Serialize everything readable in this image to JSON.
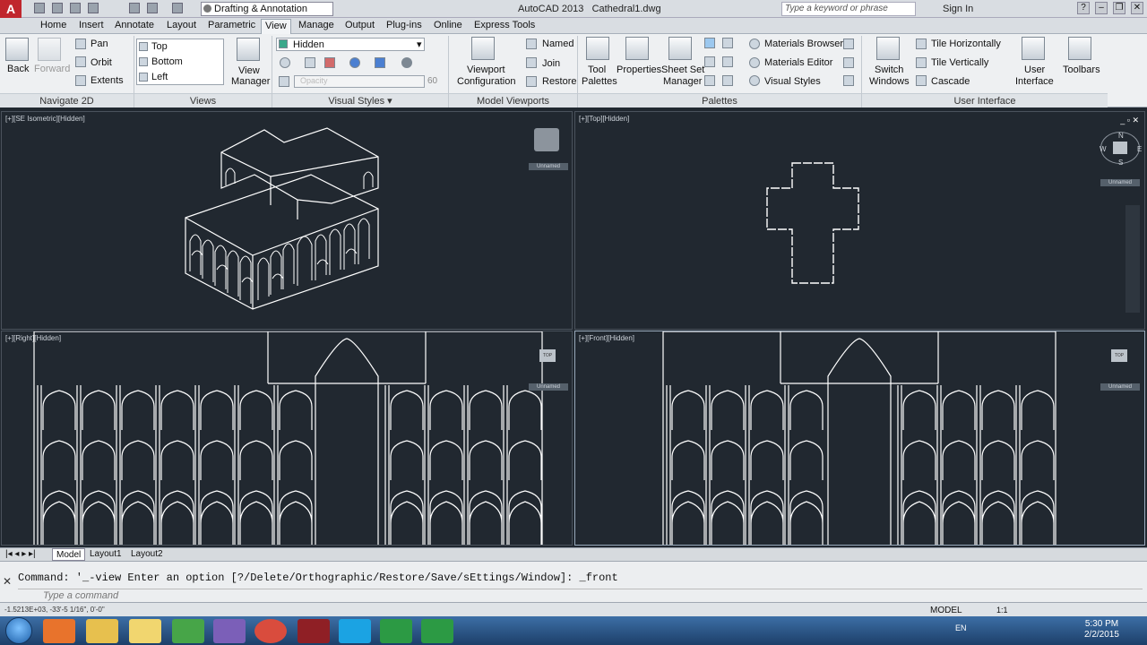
{
  "window": {
    "app_title": "AutoCAD 2013",
    "file_name": "Cathedral1.dwg",
    "workspace": "Drafting & Annotation",
    "search_placeholder": "Type a keyword or phrase",
    "sign_in": "Sign In"
  },
  "menu": {
    "tabs": [
      "Home",
      "Insert",
      "Annotate",
      "Layout",
      "Parametric",
      "View",
      "Manage",
      "Output",
      "Plug-ins",
      "Online",
      "Express Tools"
    ],
    "active": "View"
  },
  "ribbon": {
    "navigate2d": {
      "back": "Back",
      "forward": "Forward",
      "pan": "Pan",
      "orbit": "Orbit",
      "extents": "Extents",
      "title": "Navigate 2D"
    },
    "views": {
      "items": [
        "Top",
        "Bottom",
        "Left"
      ],
      "view_manager_1": "View",
      "view_manager_2": "Manager",
      "title": "Views"
    },
    "visual_styles": {
      "current": "Hidden",
      "opacity_label": "Opacity",
      "opacity_value": "60",
      "title": "Visual Styles"
    },
    "model_viewports": {
      "config_1": "Viewport",
      "config_2": "Configuration",
      "named": "Named",
      "join": "Join",
      "restore": "Restore",
      "title": "Model Viewports"
    },
    "palettes": {
      "tool_palettes_1": "Tool",
      "tool_palettes_2": "Palettes",
      "properties": "Properties",
      "sheet_set_1": "Sheet Set",
      "sheet_set_2": "Manager",
      "materials_browser": "Materials Browser",
      "materials_editor": "Materials Editor",
      "visual_styles": "Visual Styles",
      "title": "Palettes"
    },
    "user_interface": {
      "switch_1": "Switch",
      "switch_2": "Windows",
      "tile_h": "Tile Horizontally",
      "tile_v": "Tile Vertically",
      "cascade": "Cascade",
      "ui_1": "User",
      "ui_2": "Interface",
      "toolbars": "Toolbars",
      "title": "User Interface"
    }
  },
  "viewports": {
    "sw_iso": "[+][SE Isometric][Hidden]",
    "top": "[+][Top][Hidden]",
    "right": "[+][Right][Hidden]",
    "front": "[+][Front][Hidden]",
    "unnamed": "Unnamed",
    "viewcube_top": "TOP",
    "compass": {
      "n": "N",
      "w": "W",
      "e": "E",
      "s": "S"
    }
  },
  "layout_tabs": [
    "Model",
    "Layout1",
    "Layout2"
  ],
  "command": {
    "history": "Command: '_-view Enter an option [?/Delete/Orthographic/Restore/Save/sEttings/Window]: _front",
    "placeholder": "Type a command"
  },
  "status": {
    "coords": "-1.5213E+03, -33'-5 1/16\", 0'-0\"",
    "model": "MODEL",
    "scale": "1:1"
  },
  "taskbar": {
    "lang": "EN",
    "time": "5:30 PM",
    "date": "2/2/2015"
  }
}
